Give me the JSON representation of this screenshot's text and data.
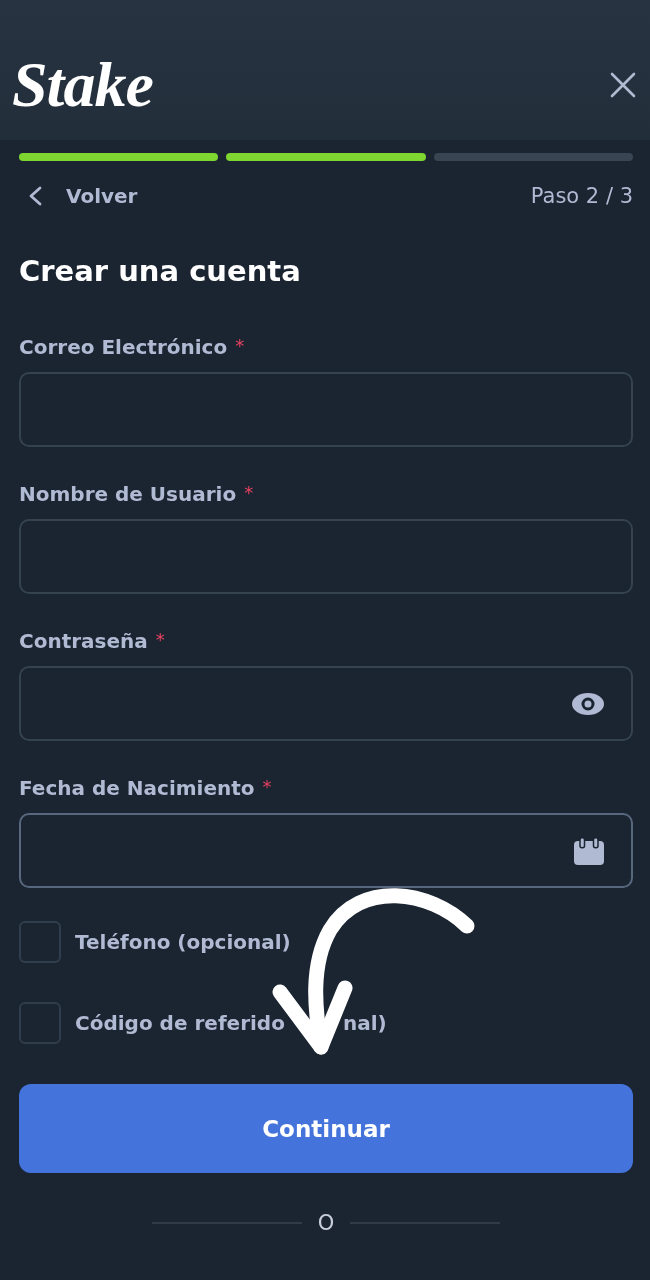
{
  "header": {
    "logo": "Stake"
  },
  "progress": {
    "steps": [
      {
        "completed": true
      },
      {
        "completed": true
      },
      {
        "completed": false
      }
    ]
  },
  "nav": {
    "back": "Volver",
    "step": "Paso 2 / 3"
  },
  "title": "Crear una cuenta",
  "fields": [
    {
      "label": "Correo Electrónico",
      "required_mark": "*",
      "kind": "text",
      "focused": false
    },
    {
      "label": "Nombre de Usuario",
      "required_mark": "*",
      "kind": "text",
      "focused": false
    },
    {
      "label": "Contraseña",
      "required_mark": "*",
      "kind": "password",
      "focused": false
    },
    {
      "label": "Fecha de Nacimiento",
      "required_mark": "*",
      "kind": "date",
      "focused": true
    }
  ],
  "options": [
    {
      "label": "Teléfono (opcional)",
      "checked": false
    },
    {
      "label": "Código de referido",
      "label_tail": "nal)",
      "checked": false
    }
  ],
  "submit": {
    "label": "Continuar"
  },
  "divider": {
    "label": "O"
  }
}
